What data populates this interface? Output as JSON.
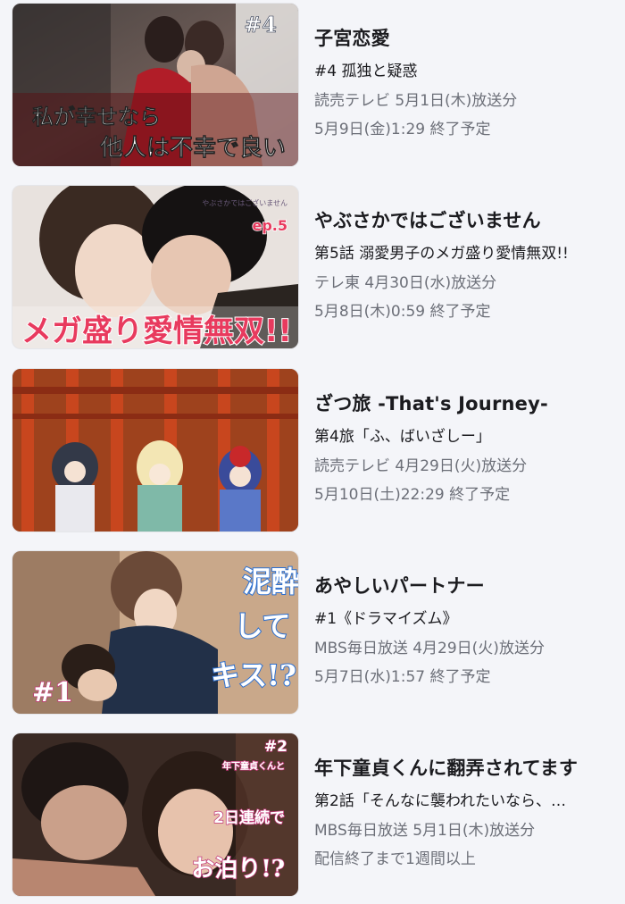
{
  "items": [
    {
      "title": "子宮恋愛",
      "episode": "#4 孤独と疑惑",
      "broadcast": "読売テレビ 5月1日(木)放送分",
      "expiry": "5月9日(金)1:29 終了予定",
      "thumb": {
        "badge": "#4",
        "line1": "私が幸せなら",
        "line2": "他人は不幸で良い"
      }
    },
    {
      "title": "やぶさかではございません",
      "episode": "第5話 溺愛男子のメガ盛り愛情無双!!",
      "broadcast": "テレ東 4月30日(水)放送分",
      "expiry": "5月8日(木)0:59 終了予定",
      "thumb": {
        "caption": "メガ盛り愛情無双!!",
        "badge": "ep.5",
        "logo": "やぶさかではございません"
      }
    },
    {
      "title": "ざつ旅 -That's Journey-",
      "episode": "第4旅「ふ、ばいざしー」",
      "broadcast": "読売テレビ 4月29日(火)放送分",
      "expiry": "5月10日(土)22:29 終了予定",
      "thumb": {}
    },
    {
      "title": "あやしいパートナー",
      "episode": "#1《ドラマイズム》",
      "broadcast": "MBS毎日放送 4月29日(火)放送分",
      "expiry": "5月7日(水)1:57 終了予定",
      "thumb": {
        "badge": "#1",
        "col1": "泥酔",
        "col2": "して",
        "col3": "キス!?"
      }
    },
    {
      "title": "年下童貞くんに翻弄されてます",
      "episode": "第2話「そんなに襲われたいなら、…",
      "broadcast": "MBS毎日放送 5月1日(木)放送分",
      "expiry": "配信終了まで1週間以上",
      "thumb": {
        "badge": "#2",
        "col1": "年下童貞くんと",
        "col2": "2日連続で",
        "col3": "お泊り!?"
      }
    }
  ]
}
